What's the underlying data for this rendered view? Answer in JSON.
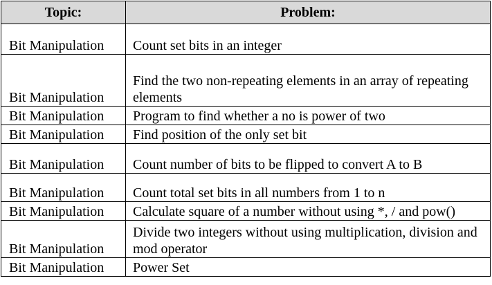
{
  "table": {
    "headers": {
      "topic": "Topic:",
      "problem": "Problem:"
    },
    "rows": [
      {
        "topic": "Bit Manipulation",
        "problem": "Count set bits in an integer"
      },
      {
        "topic": "Bit Manipulation",
        "problem": "Find the two non-repeating elements in an array of repeating elements"
      },
      {
        "topic": "Bit Manipulation",
        "problem": "Program to find whether a no is power of two"
      },
      {
        "topic": "Bit Manipulation",
        "problem": "Find position of the only set bit"
      },
      {
        "topic": "Bit Manipulation",
        "problem": "Count number of bits to be flipped to convert A to B"
      },
      {
        "topic": "Bit Manipulation",
        "problem": "Count total set bits in all numbers from 1 to n"
      },
      {
        "topic": "Bit Manipulation",
        "problem": "Calculate square of a number without using *, / and pow()"
      },
      {
        "topic": "Bit Manipulation",
        "problem": "Divide two integers without using multiplication, division and mod operator"
      },
      {
        "topic": "Bit Manipulation",
        "problem": "Power Set"
      }
    ]
  }
}
